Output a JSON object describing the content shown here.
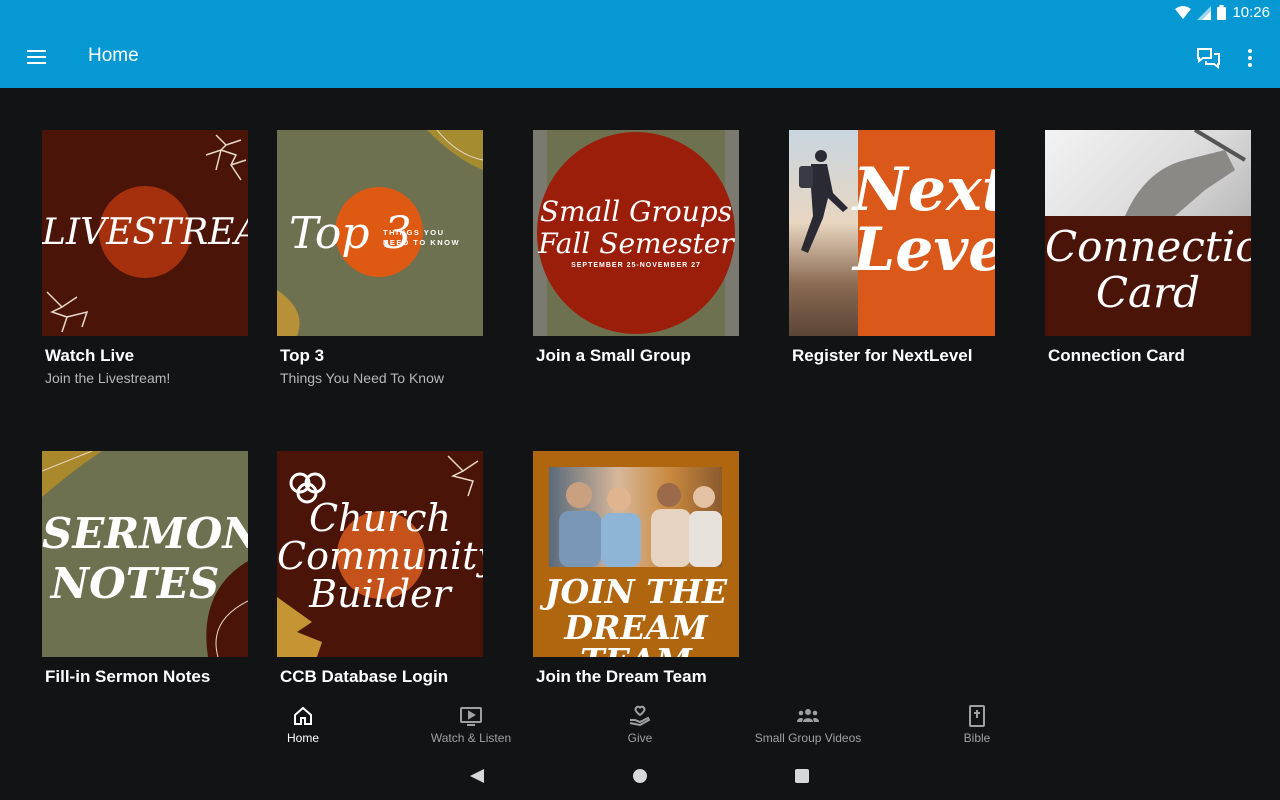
{
  "status": {
    "time": "10:26"
  },
  "app_bar": {
    "title": "Home"
  },
  "cards": [
    {
      "title": "Watch Live",
      "subtitle": "Join the Livestream!",
      "image_text": "LIVESTREAM"
    },
    {
      "title": "Top 3",
      "subtitle": "Things You Need To Know",
      "image_text": "Top 3",
      "image_subtext_1": "THINGS YOU",
      "image_subtext_2": "NEED TO KNOW"
    },
    {
      "title": "Join a Small Group",
      "subtitle": "",
      "image_text_1": "Small Groups",
      "image_text_2": "Fall Semester",
      "image_subtext": "SEPTEMBER 25-NOVEMBER 27"
    },
    {
      "title": "Register for NextLevel",
      "subtitle": "",
      "image_text_1": "Next",
      "image_text_2": "Level"
    },
    {
      "title": "Connection Card",
      "subtitle": "",
      "image_text_1": "Connection",
      "image_text_2": "Card"
    },
    {
      "title": "Fill-in Sermon Notes",
      "subtitle": "",
      "image_text_1": "SERMON",
      "image_text_2": "NOTES"
    },
    {
      "title": "CCB Database Login",
      "subtitle": "",
      "image_text_1": "Church",
      "image_text_2": "Community",
      "image_text_3": "Builder"
    },
    {
      "title": "Join the Dream Team",
      "subtitle": "",
      "image_text_1": "JOIN THE",
      "image_text_2": "DREAM TEAM"
    }
  ],
  "bottom_nav": [
    {
      "label": "Home",
      "icon": "home-icon",
      "active": true
    },
    {
      "label": "Watch & Listen",
      "icon": "tv-play-icon",
      "active": false
    },
    {
      "label": "Give",
      "icon": "give-heart-hand-icon",
      "active": false
    },
    {
      "label": "Small Group Videos",
      "icon": "group-people-icon",
      "active": false
    },
    {
      "label": "Bible",
      "icon": "bible-icon",
      "active": false
    }
  ],
  "colors": {
    "app_bar": "#0598d3",
    "background": "#121315",
    "accent_orange": "#d9581a",
    "maroon": "#4a1409",
    "olive": "#6e7150"
  }
}
